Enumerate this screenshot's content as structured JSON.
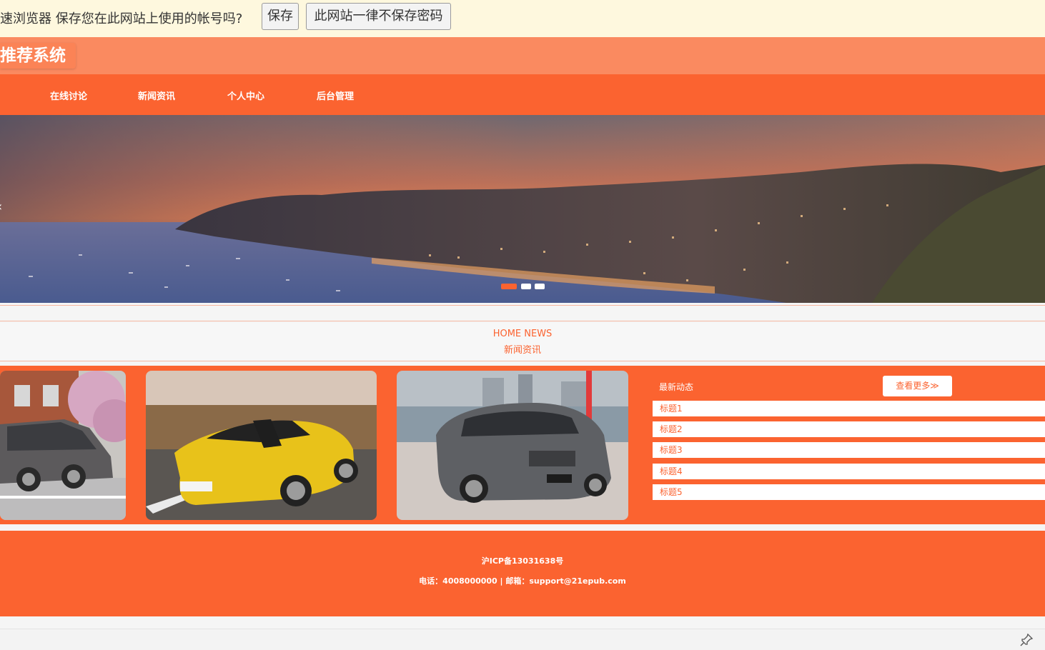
{
  "password_prompt": {
    "message": "速浏览器 保存您在此网站上使用的帐号吗?",
    "save_label": "保存",
    "never_label": "此网站一律不保存密码"
  },
  "site": {
    "title": "推荐系统"
  },
  "nav": {
    "items": [
      {
        "label": "在线讨论"
      },
      {
        "label": "新闻资讯"
      },
      {
        "label": "个人中心"
      },
      {
        "label": "后台管理"
      }
    ]
  },
  "banner": {
    "slide_count": 3,
    "active_slide": 1
  },
  "news_section": {
    "title_en": "HOME NEWS",
    "title_cn": "新闻资讯"
  },
  "sidebar": {
    "title": "最新动态",
    "more_label": "查看更多≫",
    "items": [
      {
        "label": "标题1"
      },
      {
        "label": "标题2"
      },
      {
        "label": "标题3"
      },
      {
        "label": "标题4"
      },
      {
        "label": "标题5"
      }
    ]
  },
  "footer": {
    "icp": "沪ICP备13031638号",
    "contact": "电话：4008000000 | 邮箱：support@21epub.com"
  },
  "colors": {
    "primary": "#fb6330",
    "title_band": "#fa8a60",
    "prompt_bg": "#fef8de"
  }
}
